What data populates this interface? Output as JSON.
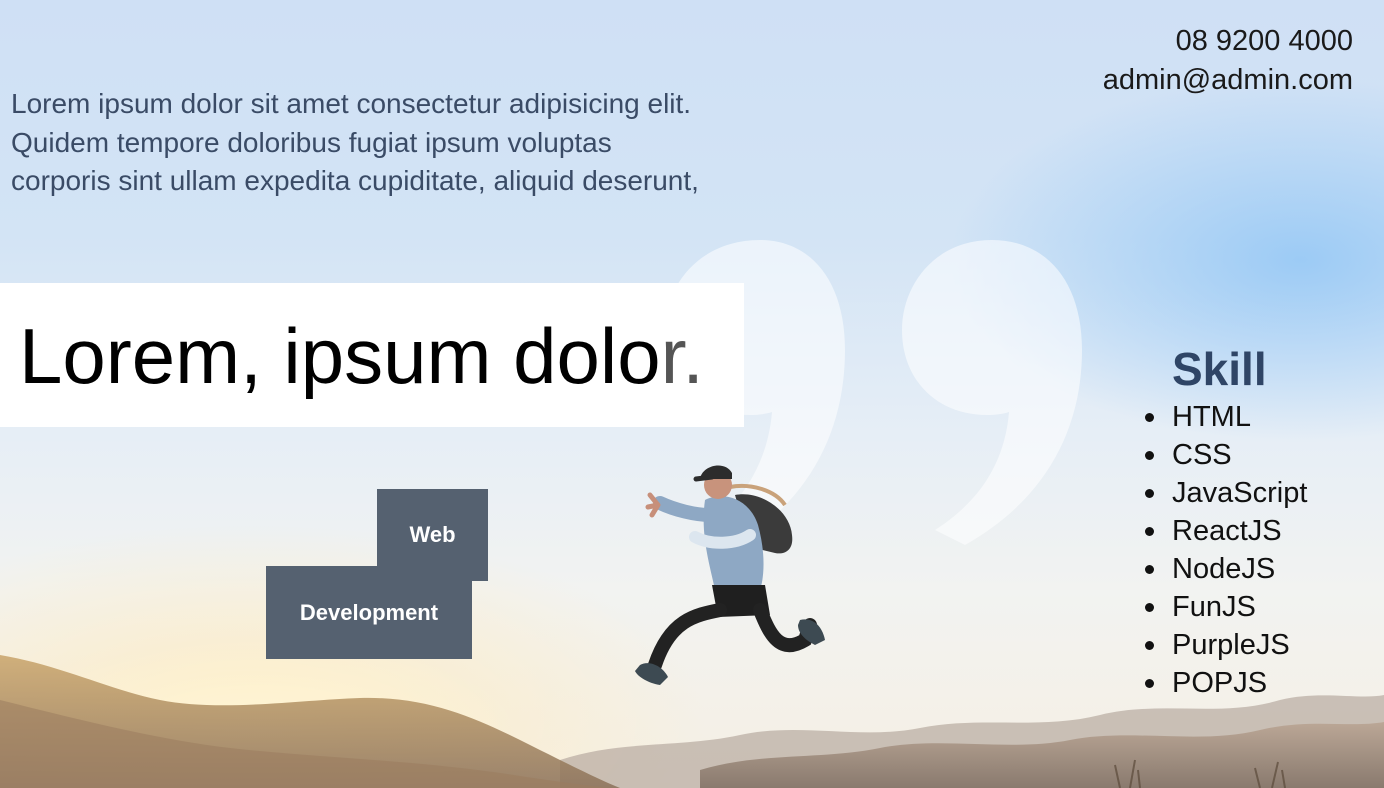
{
  "contact": {
    "phone": "08 9200 4000",
    "email": "admin@admin.com"
  },
  "intro": {
    "text": "Lorem ipsum dolor sit amet consectetur adipisicing elit. Quidem tempore doloribus fugiat ipsum voluptas corporis sint ullam expedita cupiditate, aliquid deserunt,"
  },
  "headline": {
    "main": "Lorem, ipsum dolo",
    "tail": "r."
  },
  "tags": {
    "web": "Web",
    "development": "Development"
  },
  "skills": {
    "title": "Skill",
    "items": [
      "HTML",
      "CSS",
      "JavaScript",
      "ReactJS",
      "NodeJS",
      "FunJS",
      "PurpleJS",
      "POPJS"
    ]
  },
  "colors": {
    "tag_bg": "#556170",
    "skill_title": "#2f4566",
    "intro_text": "#3a4b66"
  },
  "icons": {
    "quote": "quote-icon"
  }
}
